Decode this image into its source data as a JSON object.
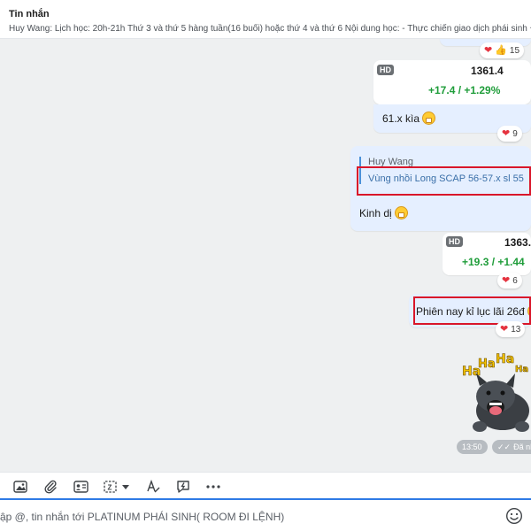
{
  "header": {
    "title": "Tin nhắn",
    "subtitle": "Huy Wang: Lịch học:  20h-21h Thứ 3 và thứ 5 hàng tuần(16 buổi) hoặc thứ 4 và thứ 6 Nội dung học:  - Thực chiến giao dịch phái sinh + cơ"
  },
  "messages": {
    "m1": {
      "reaction_count": "15",
      "reactions": [
        "heart",
        "thumbs-up"
      ]
    },
    "m2": {
      "badge": "HD",
      "price": "1361.4",
      "change": "+17.4 / +1.29%",
      "text": "61.x kìa",
      "reaction_count": "9"
    },
    "m3": {
      "quote_author": "Huy Wang",
      "quote_text": "Vùng nhồi Long SCAP 56-57.x sl 55",
      "text": "Kinh dị"
    },
    "m4": {
      "badge": "HD",
      "price": "1363.",
      "change": "+19.3 / +1.44",
      "reaction_count": "6"
    },
    "m5": {
      "text": "Phiên nay kỉ lục lãi 26đ",
      "reaction_count": "13"
    },
    "sticker": {
      "time": "13:50",
      "status": "Đã nh"
    }
  },
  "sticker_text": {
    "ha1": "Ha",
    "ha2": "Ha",
    "ha3": "Ha",
    "ha4": "Ha"
  },
  "toolbar": {
    "icons": [
      "image-icon",
      "attach-icon",
      "contact-card-icon",
      "screenshot-icon",
      "format-text-icon",
      "quick-message-icon",
      "more-icon"
    ]
  },
  "composer": {
    "placeholder": "ập @, tin nhắn tới PLATINUM PHÁI SINH( ROOM ĐI LỆNH)"
  },
  "colors": {
    "bubble_sent": "#e5efff",
    "positive": "#1f9d3a",
    "highlight": "#d9162a",
    "accent": "#2f7be5"
  }
}
